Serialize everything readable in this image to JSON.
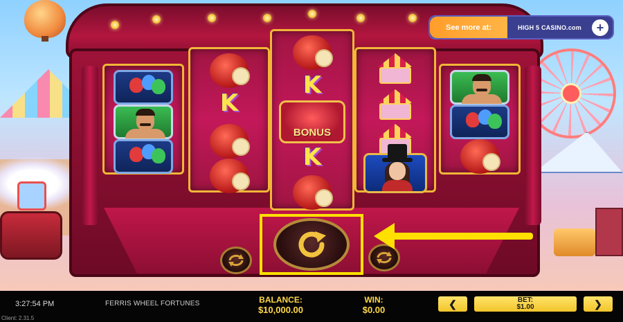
{
  "promo": {
    "see_more": "See more at:",
    "brand": "HIGH 5 CASINO.com",
    "plus_icon": "+"
  },
  "reels": [
    {
      "symbols": [
        "balloons",
        "strongman",
        "balloons"
      ]
    },
    {
      "symbols": [
        "candy-apple",
        "letter-k",
        "candy-apple",
        "candy-apple"
      ]
    },
    {
      "symbols": [
        "candy-apple",
        "letter-k",
        "bonus",
        "letter-k",
        "candy-apple"
      ]
    },
    {
      "symbols": [
        "carousel",
        "carousel",
        "carousel",
        "magician"
      ]
    },
    {
      "symbols": [
        "strongman",
        "balloons",
        "candy-apple"
      ]
    }
  ],
  "symbols": {
    "letter_k": "K",
    "bonus_label": "BONUS"
  },
  "controls": {
    "spin_icon": "refresh-icon",
    "autoplay_icon": "autoplay-icon",
    "quickspin_icon": "turbo-icon"
  },
  "status_bar": {
    "time": "3:27:54 PM",
    "game_title": "FERRIS WHEEL FORTUNES",
    "client_version": "Client: 2.31.5",
    "balance_label": "BALANCE:",
    "balance_value": "$10,000.00",
    "win_label": "WIN:",
    "win_value": "$0.00",
    "bet_label": "BET:",
    "bet_value": "$1.00",
    "bet_decrease": "❮",
    "bet_increase": "❯"
  },
  "colors": {
    "highlight": "#ffe000",
    "frame": "#b3163f",
    "gold": "#f2b637",
    "status_text": "#ffd84a"
  }
}
